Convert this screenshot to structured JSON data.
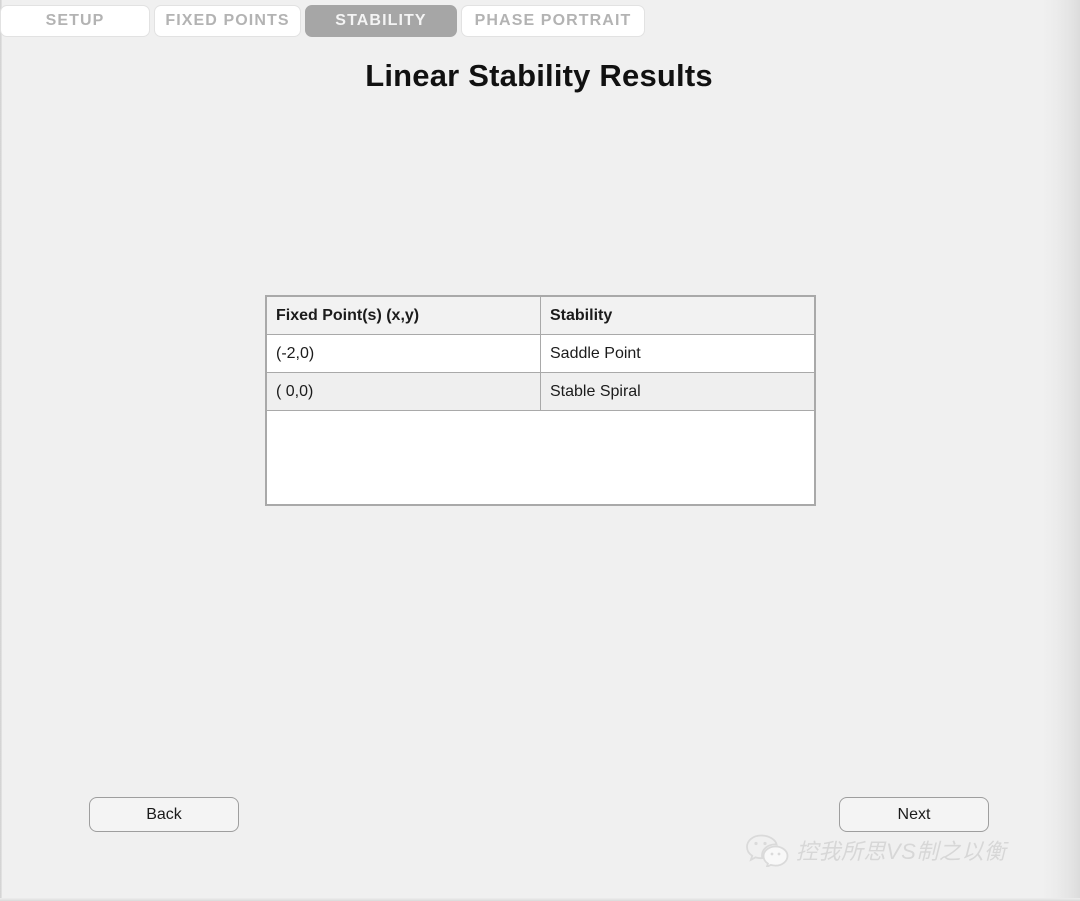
{
  "window": {
    "title": "Linear Stability Results"
  },
  "tabs": [
    {
      "id": "setup",
      "label": "SETUP",
      "active": false
    },
    {
      "id": "fixed-points",
      "label": "FIXED POINTS",
      "active": false
    },
    {
      "id": "stability",
      "label": "STABILITY",
      "active": true
    },
    {
      "id": "phase-portrait",
      "label": "PHASE PORTRAIT",
      "active": false
    }
  ],
  "table": {
    "headers": [
      "Fixed Point(s) (x,y)",
      "Stability"
    ],
    "rows": [
      {
        "fixed_point": "(-2,0)",
        "stability": "Saddle Point"
      },
      {
        "fixed_point": "( 0,0)",
        "stability": "Stable Spiral"
      }
    ]
  },
  "navigation": {
    "back_label": "Back",
    "next_label": "Next"
  },
  "watermark": {
    "icon": "wechat-icon",
    "text": "控我所思VS制之以衡"
  },
  "colors": {
    "page_background": "#f0f0f0",
    "active_tab_background": "#a6a6a6",
    "active_tab_text": "#f4f4f4",
    "inactive_tab_text": "#b3b3b3",
    "table_border": "#a9a9a9",
    "header_row_background": "#f2f2f2",
    "alt_row_background": "#efefef",
    "title_text": "#111111"
  }
}
